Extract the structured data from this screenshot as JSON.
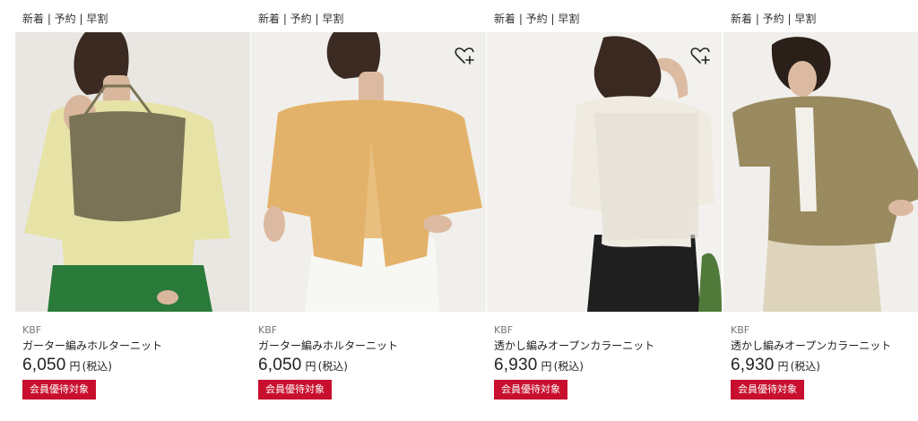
{
  "products": [
    {
      "tags": "新着 | 予約 | 早割",
      "brand": "KBF",
      "name": "ガーター編みホルターニット",
      "price": "6,050",
      "currency": "円",
      "tax": "(税込)",
      "badge": "会員優待対象",
      "colors": {
        "bg": "#e9e7e2",
        "top": "#e7e2a6",
        "knit": "#7a7356",
        "hair": "#3a2a22",
        "skin": "#d9b79c",
        "pants": "#2a7a3a"
      }
    },
    {
      "tags": "新着 | 予約 | 早割",
      "brand": "KBF",
      "name": "ガーター編みホルターニット",
      "price": "6,050",
      "currency": "円",
      "tax": "(税込)",
      "badge": "会員優待対象",
      "colors": {
        "bg": "#f1efec",
        "top": "#e8bf7e",
        "knit": "#e3b26a",
        "hair": "#3b2b22",
        "skin": "#dcbaa1",
        "pants": "#f7f7f4"
      }
    },
    {
      "tags": "新着 | 予約 | 早割",
      "brand": "KBF",
      "name": "透かし編みオープンカラーニット",
      "price": "6,930",
      "currency": "円",
      "tax": "(税込)",
      "badge": "会員優待対象",
      "colors": {
        "bg": "#f2f1ee",
        "top": "#efebe1",
        "knit": "#e3ded2",
        "hair": "#3a2920",
        "skin": "#dcbba3",
        "pants": "#1f1f1f"
      }
    },
    {
      "tags": "新着 | 予約 | 早割",
      "brand": "KBF",
      "name": "透かし編みオープンカラーニット",
      "price": "6,930",
      "currency": "円",
      "tax": "(税込)",
      "badge": "会員優待対象",
      "colors": {
        "bg": "#f1efec",
        "top": "#9a8a60",
        "knit": "#8a7c55",
        "hair": "#2b2019",
        "skin": "#dcbaa1",
        "pants": "#ded4bc"
      }
    }
  ]
}
